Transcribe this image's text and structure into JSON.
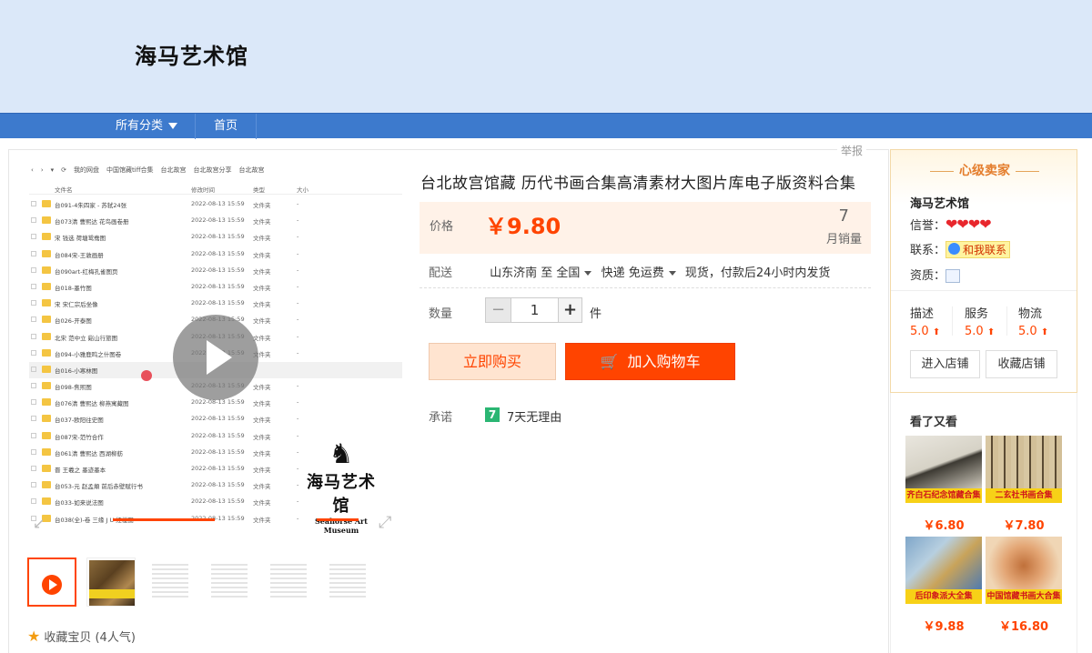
{
  "shop": {
    "title": "海马艺术馆"
  },
  "nav": {
    "categories": "所有分类",
    "home": "首页"
  },
  "report": "举报",
  "gallery": {
    "toolbar": [
      "‹",
      "›",
      "▾",
      "⟳",
      "我的网盘",
      "中国馆藏tiff合集",
      "台北故宫",
      "台北故宫分享",
      "台北故宫"
    ],
    "columns": {
      "name": "文件名",
      "date": "修改时间",
      "type": "类型",
      "size": "大小"
    },
    "rows": [
      {
        "name": "台091-4朱四家 - 苏轼24张",
        "date": "2022-08-13 15:59",
        "type": "文件夹",
        "size": "-"
      },
      {
        "name": "台073清 曹熙达 花鸟画卷册",
        "date": "2022-08-13 15:59",
        "type": "文件夹",
        "size": "-"
      },
      {
        "name": "宋 钱选 荷塘鸳鸯图",
        "date": "2022-08-13 15:59",
        "type": "文件夹",
        "size": "-"
      },
      {
        "name": "台084宋-王敦画册",
        "date": "2022-08-13 15:59",
        "type": "文件夹",
        "size": "-"
      },
      {
        "name": "台090art-红梅孔雀图页",
        "date": "2022-08-13 15:59",
        "type": "文件夹",
        "size": "-"
      },
      {
        "name": "台018-墨竹图",
        "date": "2022-08-13 15:59",
        "type": "文件夹",
        "size": "-"
      },
      {
        "name": "宋 宋仁宗后坐像",
        "date": "2022-08-13 15:59",
        "type": "文件夹",
        "size": "-"
      },
      {
        "name": "台026-开泰图",
        "date": "2022-08-13 15:59",
        "type": "文件夹",
        "size": "-"
      },
      {
        "name": "北宋 范中立 谿山行旅图",
        "date": "2022-08-13 15:59",
        "type": "文件夹",
        "size": "-"
      },
      {
        "name": "台094-小雅鹿鸣之什图卷",
        "date": "2022-08-13 15:59",
        "type": "文件夹",
        "size": "-"
      },
      {
        "name": "台016-小寒林图",
        "date": "",
        "type": "",
        "size": ""
      },
      {
        "name": "台098-焦煕图",
        "date": "2022-08-13 15:59",
        "type": "文件夹",
        "size": "-"
      },
      {
        "name": "台076清 曹熙达 柳燕寓藏图",
        "date": "2022-08-13 15:59",
        "type": "文件夹",
        "size": "-"
      },
      {
        "name": "台037-欧阳往史图",
        "date": "2022-08-13 15:59",
        "type": "文件夹",
        "size": "-"
      },
      {
        "name": "台087宋-范竹合作",
        "date": "2022-08-13 15:59",
        "type": "文件夹",
        "size": "-"
      },
      {
        "name": "台061清 曹熙达 西湖柳舫",
        "date": "2022-08-13 15:59",
        "type": "文件夹",
        "size": "-"
      },
      {
        "name": "晋 王羲之 墨迹墨本",
        "date": "2022-08-13 15:59",
        "type": "文件夹",
        "size": "-"
      },
      {
        "name": "台053-元 赵孟頫 前后赤壁赋行书",
        "date": "2022-08-13 15:59",
        "type": "文件夹",
        "size": "-"
      },
      {
        "name": "台033-如来说法图",
        "date": "2022-08-13 15:59",
        "type": "文件夹",
        "size": "-"
      },
      {
        "name": "台038(全)-卷 三缘 J U 红楼图",
        "date": "2022-08-13 15:59",
        "type": "文件夹",
        "size": "-"
      }
    ],
    "watermark": {
      "cn": "海马艺术馆",
      "en": "Seahorse Art Museum"
    }
  },
  "favorite": "收藏宝贝 (4人气)",
  "product": {
    "title": "台北故宫馆藏 历代书画合集高清素材大图片库电子版资料合集",
    "price_label": "价格",
    "price": "￥9.80",
    "sales_count": "7",
    "sales_label": "月销量",
    "ship_label": "配送",
    "ship_from": "山东济南 至",
    "ship_to": "全国",
    "ship_method": "快递 免运费",
    "ship_note": "现货，付款后24小时内发货",
    "qty_label": "数量",
    "qty_minus": "−",
    "qty_value": "1",
    "qty_plus": "+",
    "qty_unit": "件",
    "buy_now": "立即购买",
    "add_cart": "加入购物车",
    "promise_label": "承诺",
    "promise_badge": "7",
    "promise_text": "7天无理由"
  },
  "seller": {
    "level": "心级卖家",
    "name": "海马艺术馆",
    "credit_label": "信誉：",
    "hearts": "❤❤❤❤",
    "contact_label": "联系：",
    "contact_link": "和我联系",
    "qual_label": "资质：",
    "scores": [
      {
        "label": "描述",
        "value": "5.0"
      },
      {
        "label": "服务",
        "value": "5.0"
      },
      {
        "label": "物流",
        "value": "5.0"
      }
    ],
    "enter_shop": "进入店铺",
    "fav_shop": "收藏店铺"
  },
  "also_viewed": {
    "title": "看了又看",
    "items": [
      {
        "price": "￥6.80",
        "band": "齐白石纪念馆藏合集"
      },
      {
        "price": "￥7.80",
        "band": "二玄社书画合集"
      },
      {
        "price": "￥9.88",
        "band": "后印象派大全集"
      },
      {
        "price": "￥16.80",
        "band": "中国馆藏书画大合集"
      }
    ]
  },
  "colors": {
    "accent": "#ff4400",
    "nav": "#3d7acd",
    "banner": "#dbe8f9"
  }
}
